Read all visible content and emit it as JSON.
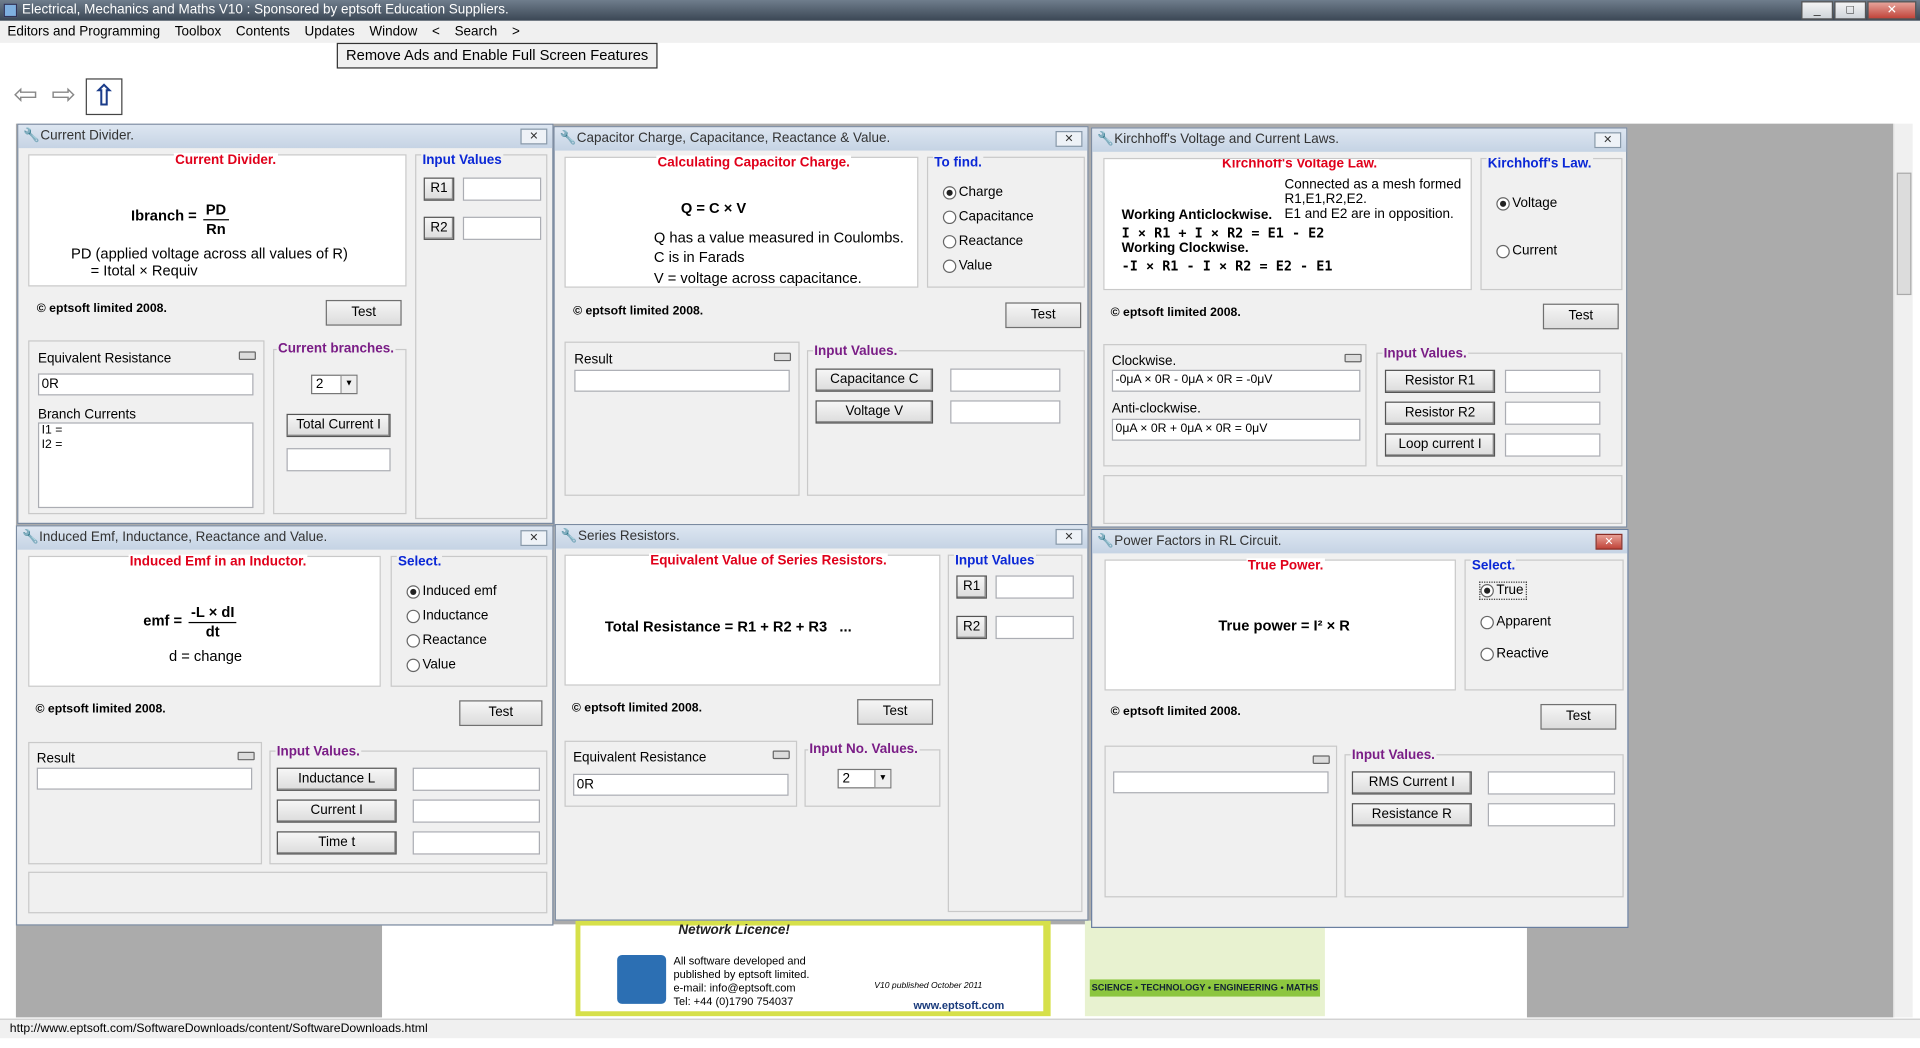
{
  "app": {
    "title": "Electrical, Mechanics and Maths V10 : Sponsored by eptsoft Education Suppliers.",
    "window_buttons": [
      "_",
      "□",
      "✕"
    ]
  },
  "menu": [
    "Editors and Programming",
    "Toolbox",
    "Contents",
    "Updates",
    "Window",
    "<",
    "Search",
    ">"
  ],
  "ad_button": "Remove Ads and Enable Full Screen Features",
  "status_url": "http://www.eptsoft.com/SoftwareDownloads/content/SoftwareDownloads.html",
  "icons": {
    "back": "back-arrow-icon",
    "forward": "forward-arrow-icon",
    "up": "up-arrow-icon"
  },
  "common": {
    "copyright": "© eptsoft limited 2008.",
    "test": "Test"
  },
  "w1": {
    "title": "Current Divider.",
    "heading": "Current Divider.",
    "f_lhs": "Ibranch =",
    "f_num": "PD",
    "f_den": "Rn",
    "desc1": "PD (applied voltage across all values of R)",
    "desc2": "= Itotal × Requiv",
    "inputs_label": "Input Values",
    "r1": "R1",
    "r2": "R2",
    "eq_label": "Equivalent Resistance",
    "eq_value": "0R",
    "branch_label": "Branch Currents",
    "branch_lines": [
      "I1 =",
      "I2 ="
    ],
    "branches_label": "Current branches.",
    "branches_value": "2",
    "total_btn": "Total Current I"
  },
  "w2": {
    "title": "Capacitor Charge, Capacitance, Reactance & Value.",
    "heading": "Calculating Capacitor Charge.",
    "f1": "Q = C × V",
    "l1": "Q has a value measured in Coulombs.",
    "l2": "C is in Farads",
    "l3": "V = voltage across capacitance.",
    "find_label": "To find.",
    "options": [
      "Charge",
      "Capacitance",
      "Reactance",
      "Value"
    ],
    "selected": "Charge",
    "result_label": "Result",
    "inputs_label": "Input Values.",
    "btn1": "Capacitance C",
    "btn2": "Voltage V"
  },
  "w3": {
    "title": "Kirchhoff's Voltage and Current Laws.",
    "heading": "Kirchhoff's Voltage Law.",
    "note1": "Connected as a mesh formed",
    "note2": "R1,E1,R2,E2.",
    "note3": "E1 and E2 are in opposition.",
    "a1": "Working Anticlockwise.",
    "a2": "I × R1 + I × R2 = E1 - E2",
    "c1": "Working Clockwise.",
    "c2": "-I × R1 - I × R2 = E2 - E1",
    "law_label": "Kirchhoff's Law.",
    "options": [
      "Voltage",
      "Current"
    ],
    "selected": "Voltage",
    "cw_label": "Clockwise.",
    "cw_value": "-0μA × 0R - 0μA × 0R = -0μV",
    "acw_label": "Anti-clockwise.",
    "acw_value": "0μA × 0R + 0μA × 0R = 0μV",
    "inputs_label": "Input Values.",
    "btn1": "Resistor R1",
    "btn2": "Resistor R2",
    "btn3": "Loop current I"
  },
  "w4": {
    "title": "Induced Emf, Inductance, Reactance and Value.",
    "heading": "Induced Emf in an Inductor.",
    "f_lhs": "emf =",
    "f_num": "-L × dI",
    "f_den": "dt",
    "desc": "d = change",
    "select_label": "Select.",
    "options": [
      "Induced emf",
      "Inductance",
      "Reactance",
      "Value"
    ],
    "selected": "Induced emf",
    "result_label": "Result",
    "inputs_label": "Input Values.",
    "btn1": "Inductance L",
    "btn2": "Current I",
    "btn3": "Time t"
  },
  "w5": {
    "title": "Series Resistors.",
    "heading": "Equivalent Value of Series Resistors.",
    "formula": "Total Resistance = R1 + R2 + R3   ...",
    "inputs_label": "Input Values",
    "r1": "R1",
    "r2": "R2",
    "eq_label": "Equivalent Resistance",
    "eq_value": "0R",
    "no_label": "Input No. Values.",
    "no_value": "2"
  },
  "w6": {
    "title": "Power Factors in RL Circuit.",
    "heading": "True Power.",
    "formula": "True power = I² × R",
    "select_label": "Select.",
    "options": [
      "True",
      "Apparent",
      "Reactive"
    ],
    "selected": "True",
    "inputs_label": "Input Values.",
    "btn1": "RMS Current I",
    "btn2": "Resistance R"
  },
  "ads": {
    "left_lines": [
      "Network Licence!",
      "All software developed and",
      "published by eptsoft limited.",
      "e-mail: info@eptsoft.com",
      "Tel: +44 (0)1790 754037",
      "V10 published October 2011",
      "www.eptsoft.com",
      "eptsoft.com"
    ],
    "right_line": "SCIENCE • TECHNOLOGY • ENGINEERING • MATHS"
  }
}
